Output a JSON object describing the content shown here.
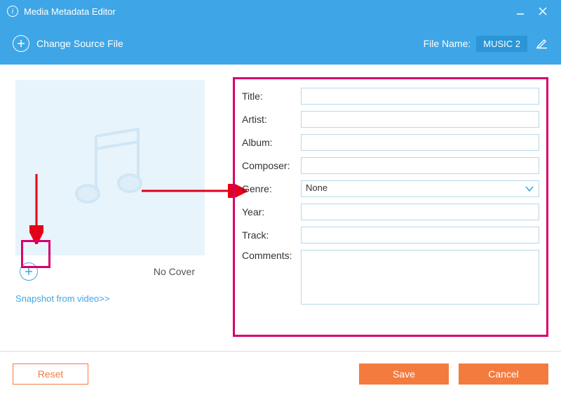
{
  "window": {
    "title": "Media Metadata Editor"
  },
  "subbar": {
    "change_source": "Change Source File",
    "filename_label": "File Name:",
    "filename_value": "MUSIC 2"
  },
  "cover": {
    "no_cover": "No Cover",
    "snapshot_link": "Snapshot from video>>"
  },
  "form": {
    "title_label": "Title:",
    "title_value": "",
    "artist_label": "Artist:",
    "artist_value": "",
    "album_label": "Album:",
    "album_value": "",
    "composer_label": "Composer:",
    "composer_value": "",
    "genre_label": "Genre:",
    "genre_value": "None",
    "year_label": "Year:",
    "year_value": "",
    "track_label": "Track:",
    "track_value": "",
    "comments_label": "Comments:",
    "comments_value": ""
  },
  "footer": {
    "reset": "Reset",
    "save": "Save",
    "cancel": "Cancel"
  }
}
